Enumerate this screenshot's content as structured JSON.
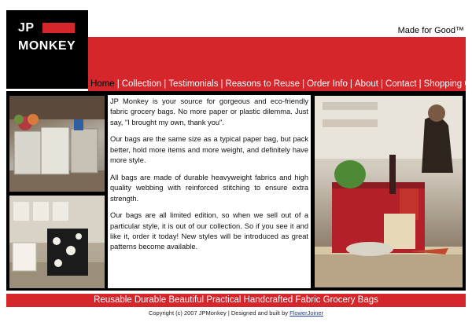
{
  "logo": {
    "line1": "JP",
    "line2": "MONKEY"
  },
  "tagline": "Made for Good™",
  "nav": {
    "items": [
      "Home",
      "Collection",
      "Testimonials",
      "Reasons to Reuse",
      "Order Info",
      "About",
      "Contact",
      "Shopping Cart"
    ],
    "separator": "|"
  },
  "intro": {
    "paragraphs": [
      "JP Monkey is your source for gorgeous and eco-friendly fabric grocery bags. No more paper or plastic dilemma. Just say, \"I brought my own, thank you\".",
      "Our bags are the same size as a typical paper bag, but pack better, hold more items and more weight, and definitely have more style.",
      "All bags are made of durable heavyweight fabrics and high quality webbing with reinforced stitching to ensure extra strength.",
      "Our bags are all limited edition, so when we sell out of a particular style, it is out of our collection. So if you see it and like it, order it today! New styles will be introduced as great patterns become available."
    ]
  },
  "footer": {
    "slogan": "Reusable Durable Beautiful Practical Handcrafted Fabric Grocery Bags",
    "copyright": "Copyright (c) 2007 JPMonkey | Designed and built by",
    "designer_link": "FlowerJoiner"
  },
  "colors": {
    "brand_red": "#d4262b",
    "black": "#000000"
  }
}
